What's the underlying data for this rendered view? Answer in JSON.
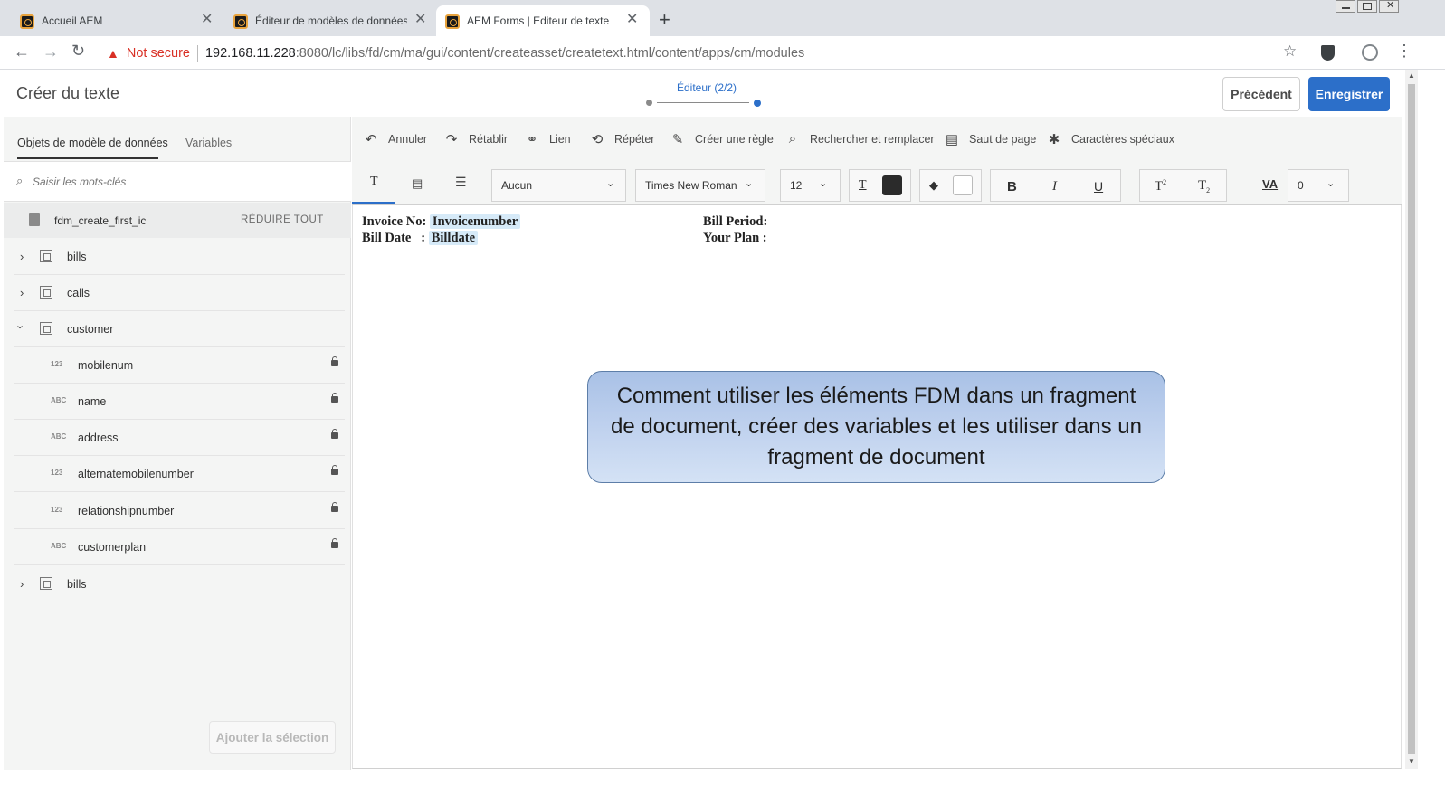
{
  "browser": {
    "tabs": [
      {
        "title": "Accueil AEM"
      },
      {
        "title": "Éditeur de modèles de données de f"
      },
      {
        "title": "AEM Forms | Editeur de texte"
      }
    ],
    "new_tab": "+",
    "security_label": "Not secure",
    "url_host": "192.168.11.228",
    "url_rest": ":8080/lc/libs/fd/cm/ma/gui/content/createasset/createtext.html/content/apps/cm/modules"
  },
  "header": {
    "title": "Créer du texte",
    "step_label": "Éditeur (2/2)",
    "previous_label": "Précédent",
    "save_label": "Enregistrer"
  },
  "left_panel": {
    "tabs": [
      "Objets de modèle de données",
      "Variables"
    ],
    "search_placeholder": "Saisir les mots-clés",
    "model_name": "fdm_create_first_ic",
    "collapse_all": "RÉDUIRE TOUT",
    "tree": [
      {
        "label": "bills",
        "kind": "folder",
        "expanded": false
      },
      {
        "label": "calls",
        "kind": "folder",
        "expanded": false
      },
      {
        "label": "customer",
        "kind": "folder",
        "expanded": true
      },
      {
        "label": "mobilenum",
        "kind": "field",
        "type": "123"
      },
      {
        "label": "name",
        "kind": "field",
        "type": "ABC"
      },
      {
        "label": "address",
        "kind": "field",
        "type": "ABC"
      },
      {
        "label": "alternatemobilenumber",
        "kind": "field",
        "type": "123"
      },
      {
        "label": "relationshipnumber",
        "kind": "field",
        "type": "123"
      },
      {
        "label": "customerplan",
        "kind": "field",
        "type": "ABC"
      },
      {
        "label": "bills",
        "kind": "folder",
        "expanded": false
      }
    ],
    "add_selection": "Ajouter la sélection"
  },
  "toolbar": {
    "undo": "Annuler",
    "redo": "Rétablir",
    "link": "Lien",
    "repeat": "Répéter",
    "create_rule": "Créer une règle",
    "find_replace": "Rechercher et remplacer",
    "page_break": "Saut de page",
    "special_chars": "Caractères spéciaux",
    "style_value": "Aucun",
    "font_value": "Times New Roman",
    "size_value": "12",
    "spacing_value": "0",
    "text_color": "#2b2b2b",
    "highlight_color": "#ffffff",
    "bold": "B",
    "italic": "I",
    "underline": "U"
  },
  "document": {
    "invoice_label": "Invoice No:",
    "invoice_value": "Invoicenumber",
    "bill_date_label": "Bill Date   :",
    "bill_date_value": "Billdate",
    "bill_period_label": "Bill Period:",
    "your_plan_label": "Your Plan :"
  },
  "callout_text": "Comment utiliser les éléments FDM dans un fragment de document, créer des variables et les utiliser dans un fragment de document"
}
